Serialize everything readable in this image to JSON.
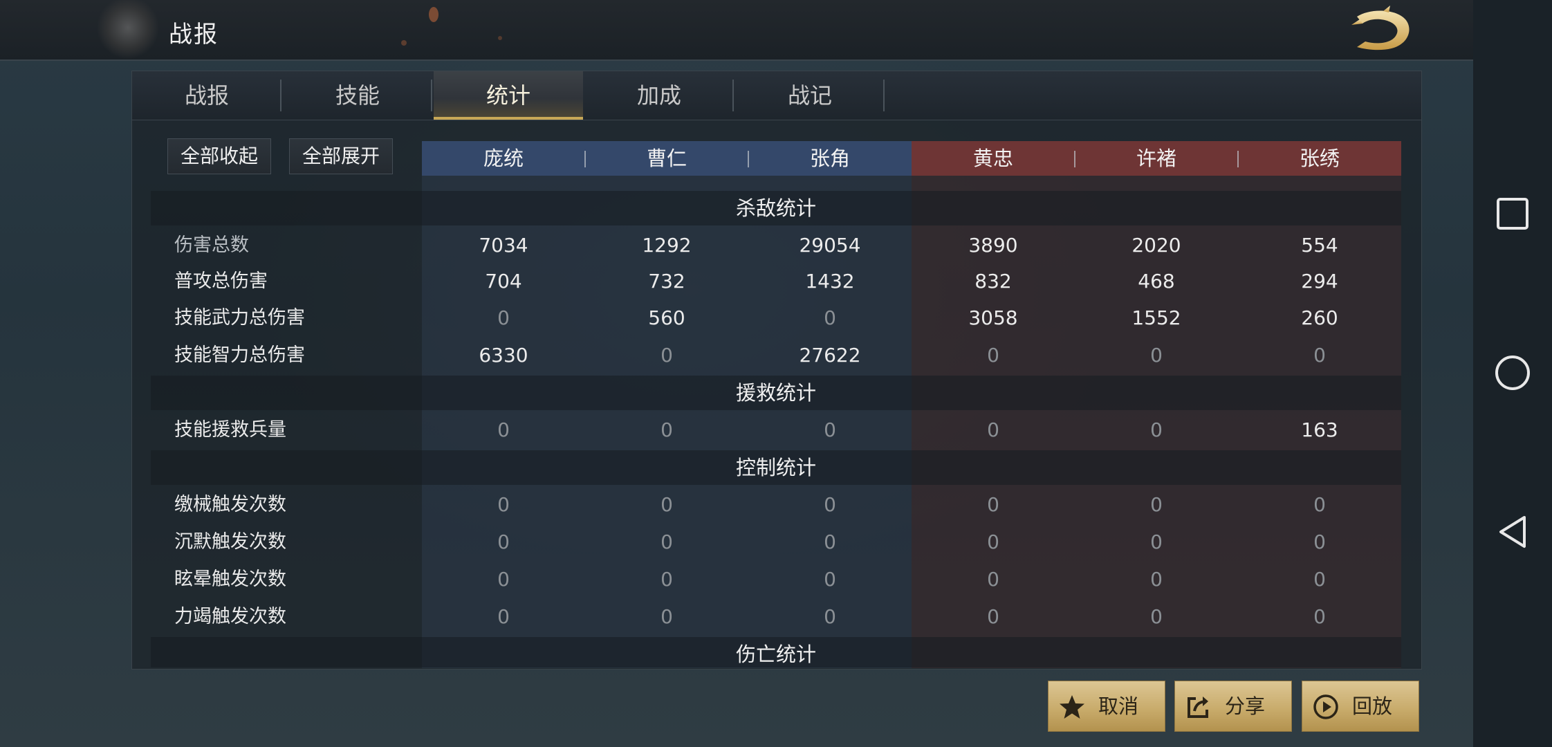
{
  "title": "战报",
  "tabs": [
    "战报",
    "技能",
    "统计",
    "加成",
    "战记"
  ],
  "active_tab": "统计",
  "buttons": {
    "collapse_all": "全部收起",
    "expand_all": "全部展开"
  },
  "team_blue": [
    "庞统",
    "曹仁",
    "张角"
  ],
  "team_red": [
    "黄忠",
    "许褚",
    "张绣"
  ],
  "sections": {
    "kill": "杀敌统计",
    "rescue": "援救统计",
    "control": "控制统计",
    "casualty": "伤亡统计"
  },
  "rows": {
    "total_damage": {
      "label": "伤害总数",
      "values": [
        "7034",
        "1292",
        "29054",
        "3890",
        "2020",
        "554"
      ]
    },
    "normal_damage": {
      "label": "普攻总伤害",
      "values": [
        "704",
        "732",
        "1432",
        "832",
        "468",
        "294"
      ]
    },
    "skill_force_damage": {
      "label": "技能武力总伤害",
      "values": [
        "0",
        "560",
        "0",
        "3058",
        "1552",
        "260"
      ]
    },
    "skill_int_damage": {
      "label": "技能智力总伤害",
      "values": [
        "6330",
        "0",
        "27622",
        "0",
        "0",
        "0"
      ]
    },
    "skill_rescue": {
      "label": "技能援救兵量",
      "values": [
        "0",
        "0",
        "0",
        "0",
        "0",
        "163"
      ]
    },
    "disarm": {
      "label": "缴械触发次数",
      "values": [
        "0",
        "0",
        "0",
        "0",
        "0",
        "0"
      ]
    },
    "silence": {
      "label": "沉默触发次数",
      "values": [
        "0",
        "0",
        "0",
        "0",
        "0",
        "0"
      ]
    },
    "stun": {
      "label": "眩晕触发次数",
      "values": [
        "0",
        "0",
        "0",
        "0",
        "0",
        "0"
      ]
    },
    "exhaust": {
      "label": "力竭触发次数",
      "values": [
        "0",
        "0",
        "0",
        "0",
        "0",
        "0"
      ]
    }
  },
  "actions": {
    "cancel": "取消",
    "share": "分享",
    "replay": "回放"
  },
  "colors": {
    "accent_gold": "#c8a857",
    "team_blue": "#34486a",
    "team_red": "#6e3535"
  },
  "icons": [
    "back-dragon-icon",
    "star-icon",
    "share-icon",
    "play-icon",
    "recent-apps-icon",
    "home-icon",
    "back-icon"
  ]
}
